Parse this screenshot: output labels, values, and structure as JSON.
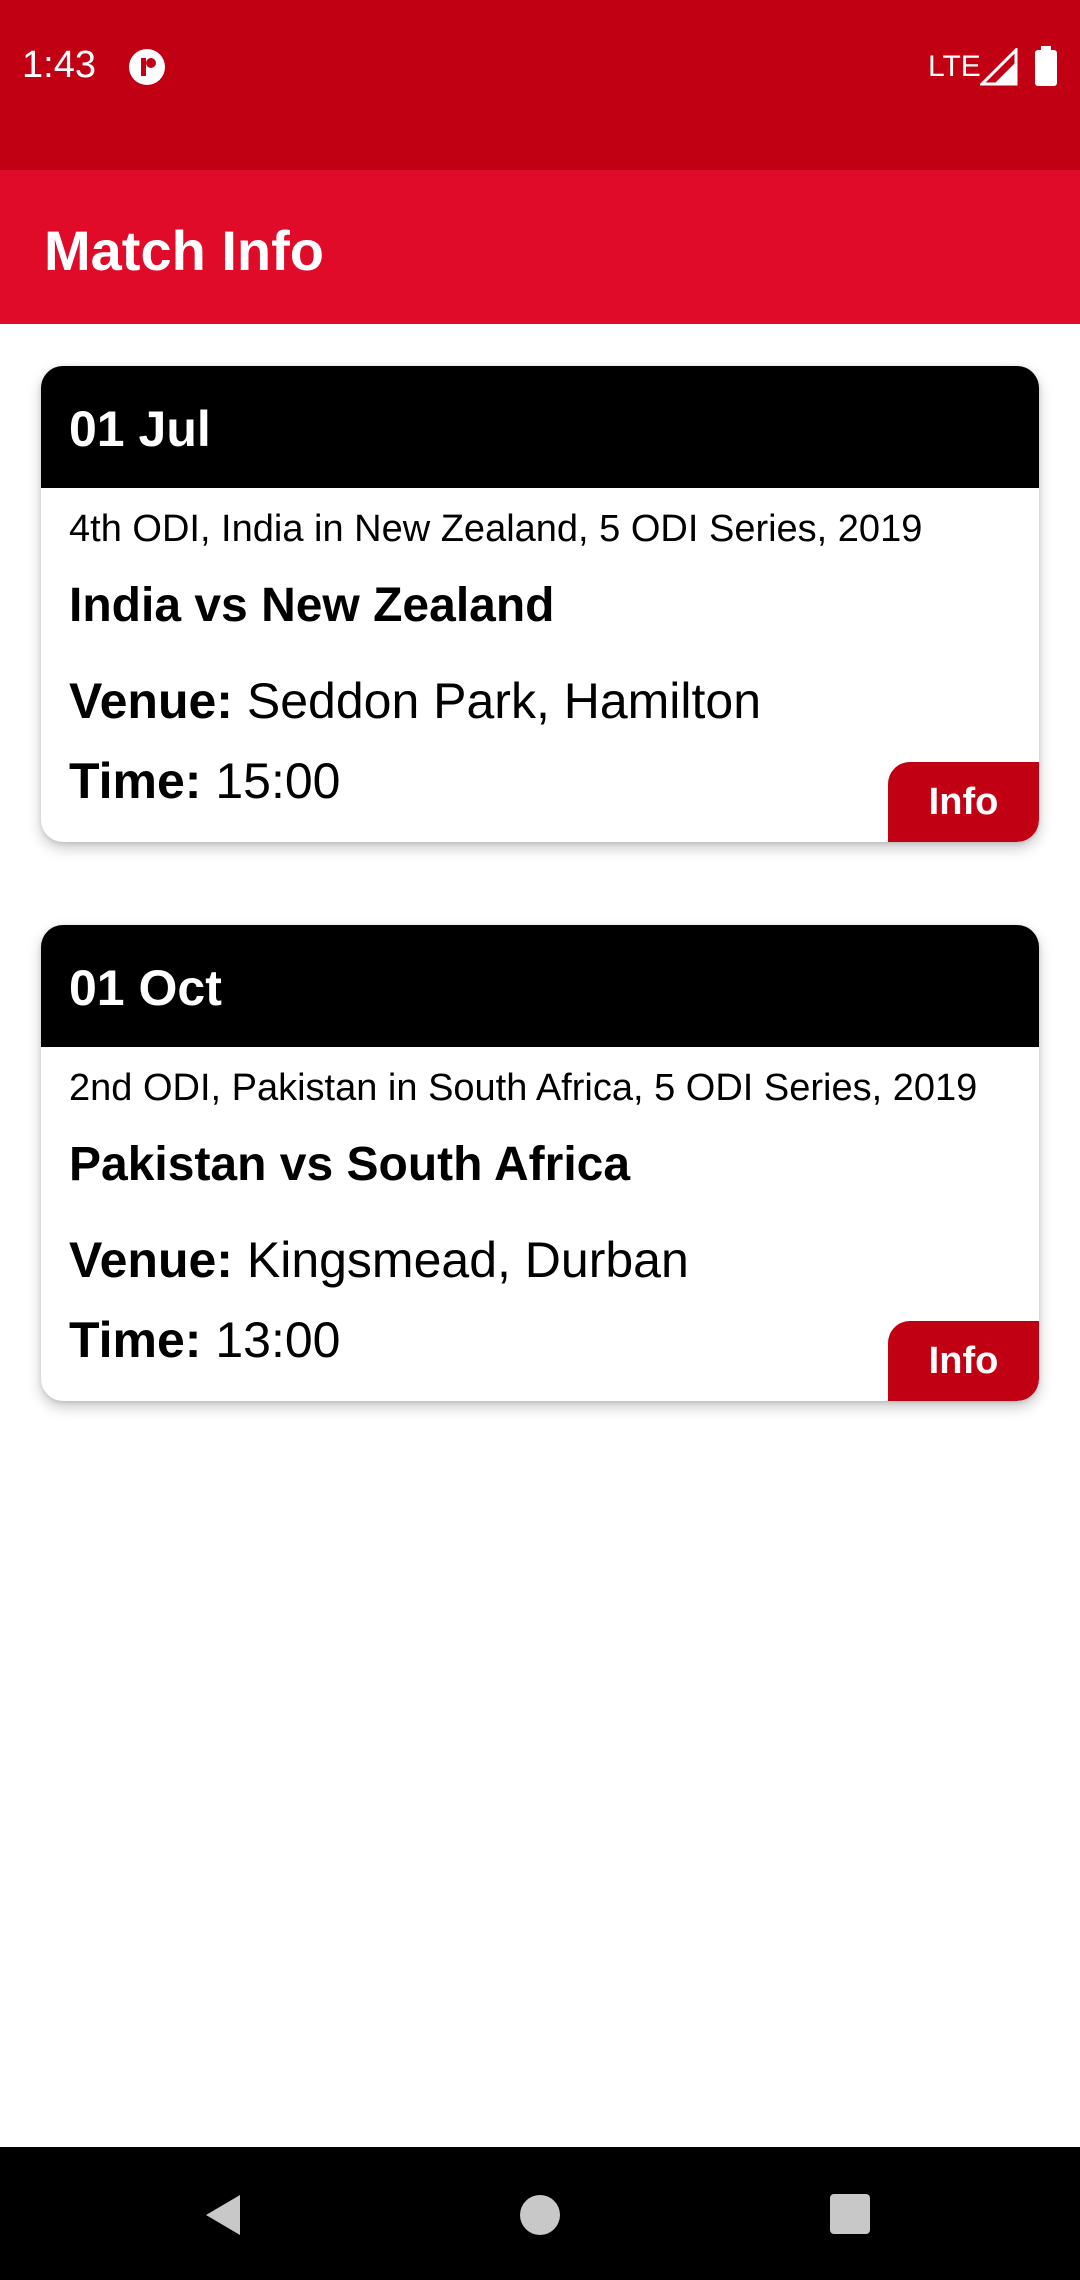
{
  "status_bar": {
    "time": "1:43",
    "network": "LTE",
    "icons": [
      "app-notification-icon",
      "signal-icon",
      "battery-icon"
    ],
    "background": "#c20013"
  },
  "app_bar": {
    "title": "Match Info",
    "background": "#e00b29"
  },
  "matches": [
    {
      "date": "01 Jul",
      "series": "4th ODI, India in New Zealand, 5 ODI Series, 2019",
      "teams": "India vs New Zealand",
      "venue_label": "Venue:",
      "venue": "Seddon Park, Hamilton",
      "time_label": "Time:",
      "time": "15:00",
      "button_label": "Info"
    },
    {
      "date": "01 Oct",
      "series": "2nd ODI, Pakistan in South Africa, 5 ODI Series, 2019",
      "teams": "Pakistan vs South Africa",
      "venue_label": "Venue:",
      "venue": "Kingsmead, Durban",
      "time_label": "Time:",
      "time": "13:00",
      "button_label": "Info"
    }
  ],
  "nav_bar": {
    "icons": [
      "back-icon",
      "home-icon",
      "recents-icon"
    ]
  },
  "colors": {
    "accent": "#c20013",
    "card_header": "#000000"
  }
}
